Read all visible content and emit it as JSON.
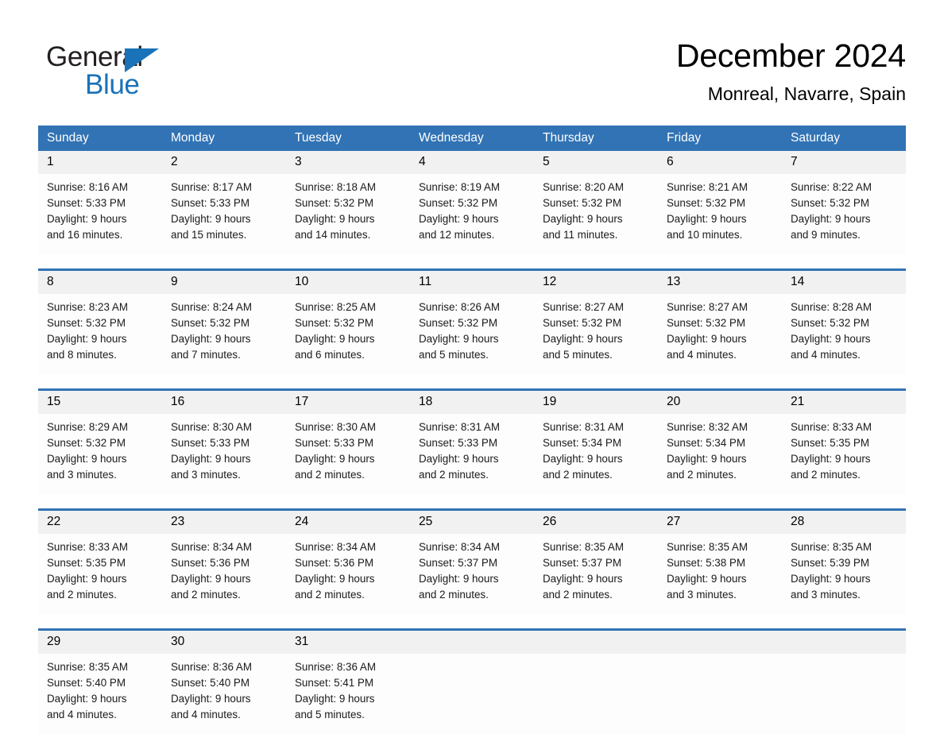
{
  "brand": {
    "name_part1": "General",
    "name_part2": "Blue",
    "triangle_icon": "triangle-icon",
    "accent_color": "#1a72b8"
  },
  "header": {
    "title": "December 2024",
    "location": "Monreal, Navarre, Spain"
  },
  "theme": {
    "header_blue": "#3173b4",
    "date_band_gray": "#f1f1f1",
    "text_black": "#000000"
  },
  "calendar": {
    "day_names": [
      "Sunday",
      "Monday",
      "Tuesday",
      "Wednesday",
      "Thursday",
      "Friday",
      "Saturday"
    ],
    "weeks": [
      [
        {
          "date": "1",
          "sunrise": "Sunrise: 8:16 AM",
          "sunset": "Sunset: 5:33 PM",
          "daylight_1": "Daylight: 9 hours",
          "daylight_2": "and 16 minutes."
        },
        {
          "date": "2",
          "sunrise": "Sunrise: 8:17 AM",
          "sunset": "Sunset: 5:33 PM",
          "daylight_1": "Daylight: 9 hours",
          "daylight_2": "and 15 minutes."
        },
        {
          "date": "3",
          "sunrise": "Sunrise: 8:18 AM",
          "sunset": "Sunset: 5:32 PM",
          "daylight_1": "Daylight: 9 hours",
          "daylight_2": "and 14 minutes."
        },
        {
          "date": "4",
          "sunrise": "Sunrise: 8:19 AM",
          "sunset": "Sunset: 5:32 PM",
          "daylight_1": "Daylight: 9 hours",
          "daylight_2": "and 12 minutes."
        },
        {
          "date": "5",
          "sunrise": "Sunrise: 8:20 AM",
          "sunset": "Sunset: 5:32 PM",
          "daylight_1": "Daylight: 9 hours",
          "daylight_2": "and 11 minutes."
        },
        {
          "date": "6",
          "sunrise": "Sunrise: 8:21 AM",
          "sunset": "Sunset: 5:32 PM",
          "daylight_1": "Daylight: 9 hours",
          "daylight_2": "and 10 minutes."
        },
        {
          "date": "7",
          "sunrise": "Sunrise: 8:22 AM",
          "sunset": "Sunset: 5:32 PM",
          "daylight_1": "Daylight: 9 hours",
          "daylight_2": "and 9 minutes."
        }
      ],
      [
        {
          "date": "8",
          "sunrise": "Sunrise: 8:23 AM",
          "sunset": "Sunset: 5:32 PM",
          "daylight_1": "Daylight: 9 hours",
          "daylight_2": "and 8 minutes."
        },
        {
          "date": "9",
          "sunrise": "Sunrise: 8:24 AM",
          "sunset": "Sunset: 5:32 PM",
          "daylight_1": "Daylight: 9 hours",
          "daylight_2": "and 7 minutes."
        },
        {
          "date": "10",
          "sunrise": "Sunrise: 8:25 AM",
          "sunset": "Sunset: 5:32 PM",
          "daylight_1": "Daylight: 9 hours",
          "daylight_2": "and 6 minutes."
        },
        {
          "date": "11",
          "sunrise": "Sunrise: 8:26 AM",
          "sunset": "Sunset: 5:32 PM",
          "daylight_1": "Daylight: 9 hours",
          "daylight_2": "and 5 minutes."
        },
        {
          "date": "12",
          "sunrise": "Sunrise: 8:27 AM",
          "sunset": "Sunset: 5:32 PM",
          "daylight_1": "Daylight: 9 hours",
          "daylight_2": "and 5 minutes."
        },
        {
          "date": "13",
          "sunrise": "Sunrise: 8:27 AM",
          "sunset": "Sunset: 5:32 PM",
          "daylight_1": "Daylight: 9 hours",
          "daylight_2": "and 4 minutes."
        },
        {
          "date": "14",
          "sunrise": "Sunrise: 8:28 AM",
          "sunset": "Sunset: 5:32 PM",
          "daylight_1": "Daylight: 9 hours",
          "daylight_2": "and 4 minutes."
        }
      ],
      [
        {
          "date": "15",
          "sunrise": "Sunrise: 8:29 AM",
          "sunset": "Sunset: 5:32 PM",
          "daylight_1": "Daylight: 9 hours",
          "daylight_2": "and 3 minutes."
        },
        {
          "date": "16",
          "sunrise": "Sunrise: 8:30 AM",
          "sunset": "Sunset: 5:33 PM",
          "daylight_1": "Daylight: 9 hours",
          "daylight_2": "and 3 minutes."
        },
        {
          "date": "17",
          "sunrise": "Sunrise: 8:30 AM",
          "sunset": "Sunset: 5:33 PM",
          "daylight_1": "Daylight: 9 hours",
          "daylight_2": "and 2 minutes."
        },
        {
          "date": "18",
          "sunrise": "Sunrise: 8:31 AM",
          "sunset": "Sunset: 5:33 PM",
          "daylight_1": "Daylight: 9 hours",
          "daylight_2": "and 2 minutes."
        },
        {
          "date": "19",
          "sunrise": "Sunrise: 8:31 AM",
          "sunset": "Sunset: 5:34 PM",
          "daylight_1": "Daylight: 9 hours",
          "daylight_2": "and 2 minutes."
        },
        {
          "date": "20",
          "sunrise": "Sunrise: 8:32 AM",
          "sunset": "Sunset: 5:34 PM",
          "daylight_1": "Daylight: 9 hours",
          "daylight_2": "and 2 minutes."
        },
        {
          "date": "21",
          "sunrise": "Sunrise: 8:33 AM",
          "sunset": "Sunset: 5:35 PM",
          "daylight_1": "Daylight: 9 hours",
          "daylight_2": "and 2 minutes."
        }
      ],
      [
        {
          "date": "22",
          "sunrise": "Sunrise: 8:33 AM",
          "sunset": "Sunset: 5:35 PM",
          "daylight_1": "Daylight: 9 hours",
          "daylight_2": "and 2 minutes."
        },
        {
          "date": "23",
          "sunrise": "Sunrise: 8:34 AM",
          "sunset": "Sunset: 5:36 PM",
          "daylight_1": "Daylight: 9 hours",
          "daylight_2": "and 2 minutes."
        },
        {
          "date": "24",
          "sunrise": "Sunrise: 8:34 AM",
          "sunset": "Sunset: 5:36 PM",
          "daylight_1": "Daylight: 9 hours",
          "daylight_2": "and 2 minutes."
        },
        {
          "date": "25",
          "sunrise": "Sunrise: 8:34 AM",
          "sunset": "Sunset: 5:37 PM",
          "daylight_1": "Daylight: 9 hours",
          "daylight_2": "and 2 minutes."
        },
        {
          "date": "26",
          "sunrise": "Sunrise: 8:35 AM",
          "sunset": "Sunset: 5:37 PM",
          "daylight_1": "Daylight: 9 hours",
          "daylight_2": "and 2 minutes."
        },
        {
          "date": "27",
          "sunrise": "Sunrise: 8:35 AM",
          "sunset": "Sunset: 5:38 PM",
          "daylight_1": "Daylight: 9 hours",
          "daylight_2": "and 3 minutes."
        },
        {
          "date": "28",
          "sunrise": "Sunrise: 8:35 AM",
          "sunset": "Sunset: 5:39 PM",
          "daylight_1": "Daylight: 9 hours",
          "daylight_2": "and 3 minutes."
        }
      ],
      [
        {
          "date": "29",
          "sunrise": "Sunrise: 8:35 AM",
          "sunset": "Sunset: 5:40 PM",
          "daylight_1": "Daylight: 9 hours",
          "daylight_2": "and 4 minutes."
        },
        {
          "date": "30",
          "sunrise": "Sunrise: 8:36 AM",
          "sunset": "Sunset: 5:40 PM",
          "daylight_1": "Daylight: 9 hours",
          "daylight_2": "and 4 minutes."
        },
        {
          "date": "31",
          "sunrise": "Sunrise: 8:36 AM",
          "sunset": "Sunset: 5:41 PM",
          "daylight_1": "Daylight: 9 hours",
          "daylight_2": "and 5 minutes."
        },
        {
          "date": "",
          "sunrise": "",
          "sunset": "",
          "daylight_1": "",
          "daylight_2": ""
        },
        {
          "date": "",
          "sunrise": "",
          "sunset": "",
          "daylight_1": "",
          "daylight_2": ""
        },
        {
          "date": "",
          "sunrise": "",
          "sunset": "",
          "daylight_1": "",
          "daylight_2": ""
        },
        {
          "date": "",
          "sunrise": "",
          "sunset": "",
          "daylight_1": "",
          "daylight_2": ""
        }
      ]
    ]
  }
}
